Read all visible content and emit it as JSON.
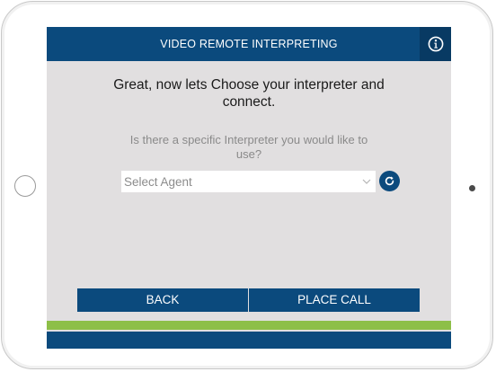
{
  "header": {
    "title": "VIDEO REMOTE INTERPRETING",
    "info_icon": "info-circle-icon"
  },
  "main": {
    "heading": "Great, now lets Choose your interpreter and connect.",
    "question": "Is there a specific Interpreter you would like to use?",
    "agent_select": {
      "placeholder": "Select Agent",
      "icon": "chevron-down-icon"
    },
    "refresh_icon": "refresh-icon"
  },
  "actions": {
    "back_label": "BACK",
    "place_call_label": "PLACE CALL"
  },
  "colors": {
    "primary": "#0b4a7d",
    "primary_dark": "#083a63",
    "accent_green": "#8dbf48",
    "screen_background": "#e1dfe0"
  }
}
